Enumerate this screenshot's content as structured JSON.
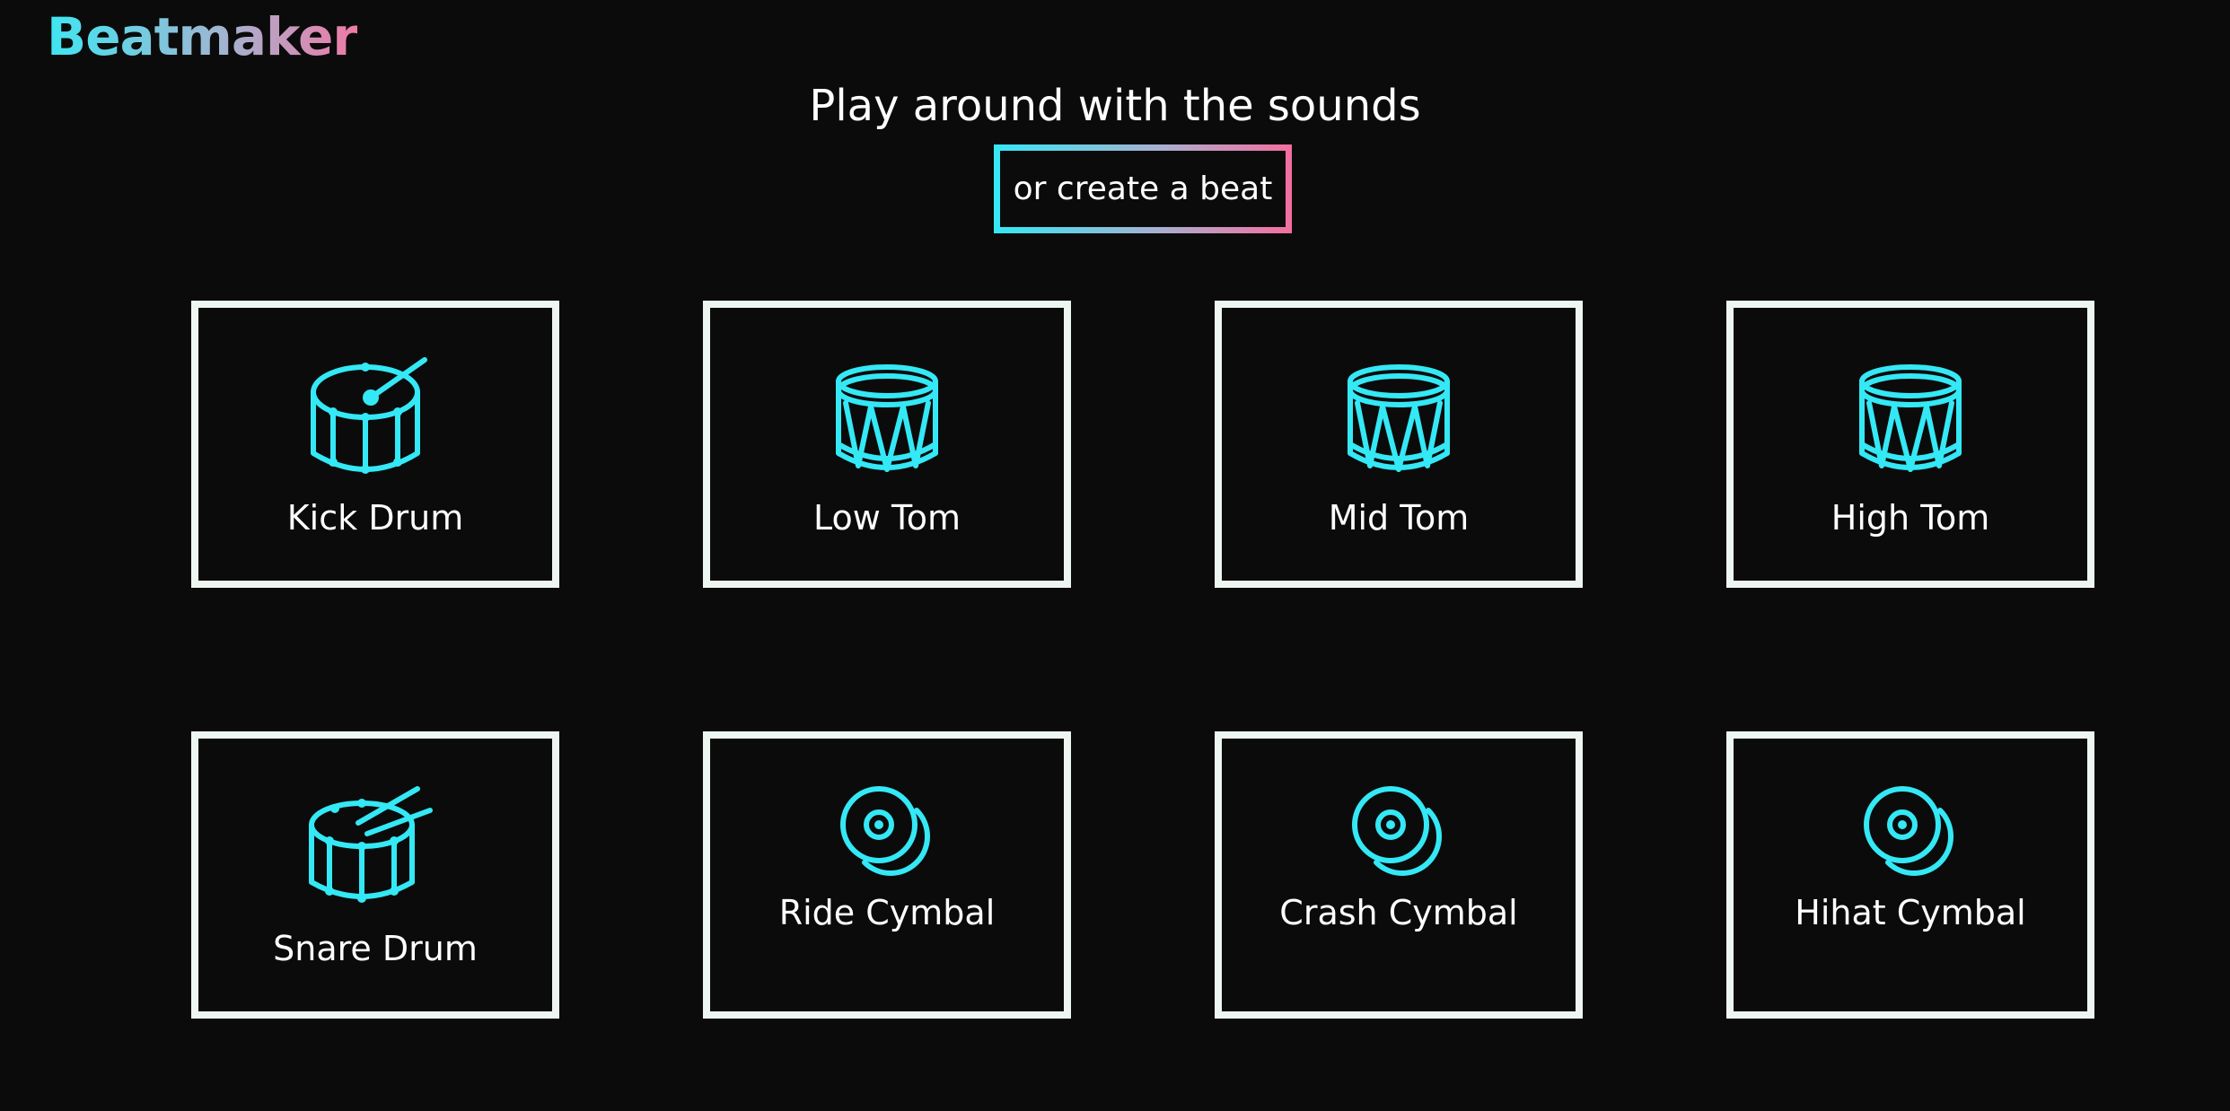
{
  "app": {
    "logo": "Beatmaker"
  },
  "hero": {
    "headline": "Play around with the sounds",
    "cta_label": "or create a beat"
  },
  "colors": {
    "background": "#0b0b0b",
    "accent_cyan": "#34e8f5",
    "accent_pink": "#f46e9f",
    "pad_border": "#eef6f2"
  },
  "pads": [
    {
      "label": "Kick Drum",
      "icon": "kick-drum-icon"
    },
    {
      "label": "Low Tom",
      "icon": "tom-drum-icon"
    },
    {
      "label": "Mid Tom",
      "icon": "tom-drum-icon"
    },
    {
      "label": "High Tom",
      "icon": "tom-drum-icon"
    },
    {
      "label": "Snare Drum",
      "icon": "snare-drum-icon"
    },
    {
      "label": "Ride Cymbal",
      "icon": "cymbal-icon"
    },
    {
      "label": "Crash Cymbal",
      "icon": "cymbal-icon"
    },
    {
      "label": "Hihat Cymbal",
      "icon": "cymbal-icon"
    }
  ]
}
